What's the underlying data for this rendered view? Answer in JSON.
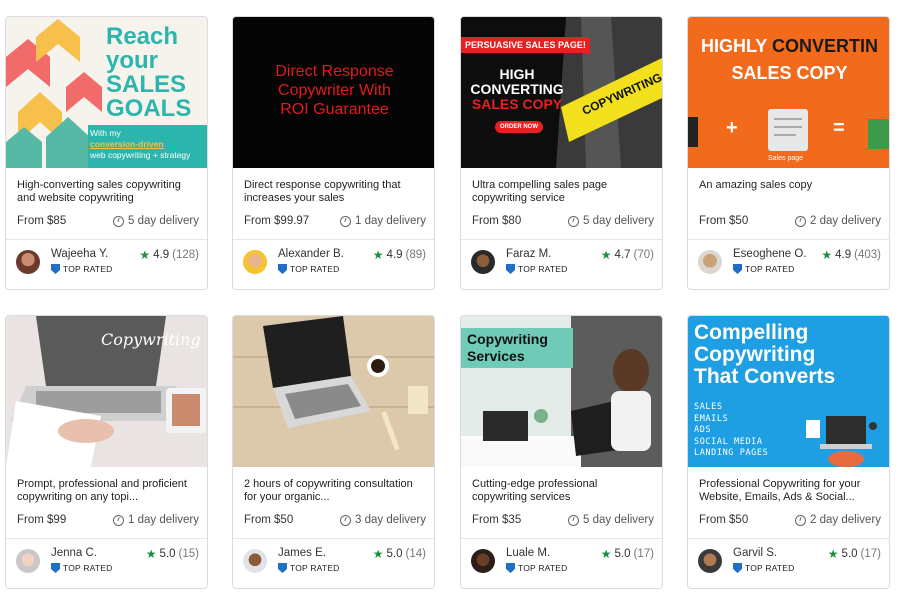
{
  "gigs": [
    {
      "thumb": {
        "lines": [
          "Reach",
          "your",
          "SALES",
          "GOALS"
        ],
        "tagline1": "With my",
        "tagline2": "conversion-driven",
        "tagline3": "web copywriting + strategy"
      },
      "title": "High-converting sales copywriting and website copywriting",
      "price": "From $85",
      "delivery": "5 day delivery",
      "seller": "Wajeeha Y.",
      "badge": "TOP RATED",
      "rating": "4.9",
      "count": "(128)"
    },
    {
      "thumb": {
        "lines": [
          "Direct Response",
          "Copywriter With",
          "ROI Guarantee"
        ]
      },
      "title": "Direct response copywriting that increases your sales",
      "price": "From $99.97",
      "delivery": "1 day delivery",
      "seller": "Alexander B.",
      "badge": "TOP RATED",
      "rating": "4.9",
      "count": "(89)"
    },
    {
      "thumb": {
        "banner": "PERSUASIVE SALES PAGE!",
        "l1": "HIGH",
        "l2": "CONVERTING",
        "l3": "SALES COPY",
        "button": "ORDER NOW",
        "tape": "COPYWRITING"
      },
      "title": "Ultra compelling sales page copywriting service",
      "price": "From $80",
      "delivery": "5 day delivery",
      "seller": "Faraz M.",
      "badge": "TOP RATED",
      "rating": "4.7",
      "count": "(70)"
    },
    {
      "thumb": {
        "l1a": "HIGHLY ",
        "l1b": "CONVERTIN",
        "l2": "SALES COPY",
        "caption": "Sales page",
        "plus": "+",
        "eq": "="
      },
      "title": "An amazing sales copy",
      "price": "From $50",
      "delivery": "2 day delivery",
      "seller": "Eseoghene O.",
      "badge": "TOP RATED",
      "rating": "4.9",
      "count": "(403)"
    },
    {
      "thumb": {
        "script": "Copywriting"
      },
      "title": "Prompt, professional and proficient copywriting on any topi...",
      "price": "From $99",
      "delivery": "1 day delivery",
      "seller": "Jenna C.",
      "badge": "TOP RATED",
      "rating": "5.0",
      "count": "(15)"
    },
    {
      "thumb": {},
      "title": "2 hours of copywriting consultation for your organic...",
      "price": "From $50",
      "delivery": "3 day delivery",
      "seller": "James E.",
      "badge": "TOP RATED",
      "rating": "5.0",
      "count": "(14)"
    },
    {
      "thumb": {
        "l1": "Copywriting",
        "l2": "Services"
      },
      "title": "Cutting-edge professional copywriting services",
      "price": "From $35",
      "delivery": "5 day delivery",
      "seller": "Luale M.",
      "badge": "TOP RATED",
      "rating": "5.0",
      "count": "(17)"
    },
    {
      "thumb": {
        "lines": [
          "Compelling",
          "Copywriting",
          "That Converts"
        ],
        "list": [
          "SALES",
          "EMAILS",
          "ADS",
          "SOCIAL MEDIA",
          "LANDING PAGES"
        ]
      },
      "title": "Professional Copywriting for your Website, Emails, Ads & Social...",
      "price": "From $50",
      "delivery": "2 day delivery",
      "seller": "Garvil S.",
      "badge": "TOP RATED",
      "rating": "5.0",
      "count": "(17)"
    }
  ],
  "colors": {
    "star": "#1c8f3e",
    "badge": "#1f6fc7",
    "border": "#d9dde2"
  }
}
